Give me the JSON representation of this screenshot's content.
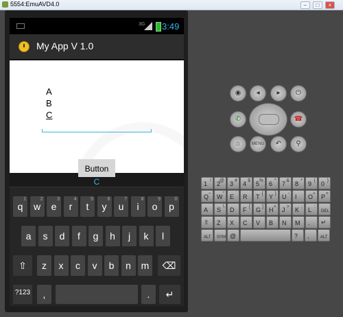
{
  "window": {
    "title": "5554:EmuAVD4.0"
  },
  "status_bar": {
    "network": "3G",
    "time": "3:49"
  },
  "app": {
    "title": "My App V 1.0",
    "list": [
      "A",
      "B",
      "C"
    ],
    "button_label": "Button"
  },
  "keyboard": {
    "suggestion": "C",
    "row1": [
      "q",
      "w",
      "e",
      "r",
      "t",
      "y",
      "u",
      "i",
      "o",
      "p"
    ],
    "row1_hints": [
      "1",
      "2",
      "3",
      "4",
      "5",
      "6",
      "7",
      "8",
      "9",
      "0"
    ],
    "row2": [
      "a",
      "s",
      "d",
      "f",
      "g",
      "h",
      "j",
      "k",
      "l"
    ],
    "row3": [
      "z",
      "x",
      "c",
      "v",
      "b",
      "n",
      "m"
    ],
    "shift_icon": "shift-icon",
    "delete_icon": "backspace-icon",
    "numbers_label": "?123",
    "comma_label": ",",
    "period_label": ".",
    "enter_icon": "enter-icon"
  },
  "emulator_controls": {
    "buttons": [
      "camera-icon",
      "volume-down-icon",
      "volume-up-icon",
      "power-icon",
      "call-icon",
      "end-call-icon",
      "home-icon",
      "MENU",
      "back-icon",
      "search-icon"
    ]
  },
  "hardware_keyboard": {
    "row1": [
      {
        "m": "1",
        "s": "!"
      },
      {
        "m": "2",
        "s": "@"
      },
      {
        "m": "3",
        "s": "#"
      },
      {
        "m": "4",
        "s": "$"
      },
      {
        "m": "5",
        "s": "%"
      },
      {
        "m": "6",
        "s": "^"
      },
      {
        "m": "7",
        "s": "&"
      },
      {
        "m": "8",
        "s": "*"
      },
      {
        "m": "9",
        "s": "("
      },
      {
        "m": "0",
        "s": ")"
      }
    ],
    "row2": [
      {
        "m": "Q",
        "s": "~"
      },
      {
        "m": "W",
        "s": "\""
      },
      {
        "m": "E",
        "s": "´"
      },
      {
        "m": "R",
        "s": ""
      },
      {
        "m": "T",
        "s": "{"
      },
      {
        "m": "Y",
        "s": "}"
      },
      {
        "m": "U",
        "s": "-"
      },
      {
        "m": "I",
        "s": ""
      },
      {
        "m": "O",
        "s": "+"
      },
      {
        "m": "P",
        "s": "="
      }
    ],
    "row3": [
      {
        "m": "A",
        "s": ""
      },
      {
        "m": "S",
        "s": "\\"
      },
      {
        "m": "D",
        "s": ""
      },
      {
        "m": "F",
        "s": "["
      },
      {
        "m": "G",
        "s": "]"
      },
      {
        "m": "H",
        "s": "<"
      },
      {
        "m": "J",
        "s": ">"
      },
      {
        "m": "K",
        "s": ";"
      },
      {
        "m": "L",
        "s": ":"
      },
      {
        "m": "DEL",
        "s": ""
      }
    ],
    "row4": [
      {
        "m": "⇧",
        "s": ""
      },
      {
        "m": "Z",
        "s": ""
      },
      {
        "m": "X",
        "s": ""
      },
      {
        "m": "C",
        "s": ""
      },
      {
        "m": "V",
        "s": ""
      },
      {
        "m": "B",
        "s": ""
      },
      {
        "m": "N",
        "s": ""
      },
      {
        "m": "M",
        "s": ""
      },
      {
        "m": ".",
        "s": ""
      },
      {
        "m": "↵",
        "s": ""
      }
    ],
    "row5": [
      {
        "m": "ALT",
        "s": ""
      },
      {
        "m": "SYM",
        "s": ""
      },
      {
        "m": "@",
        "s": ""
      },
      {
        "m": "",
        "s": ""
      },
      {
        "m": "?",
        "s": ""
      },
      {
        "m": ",",
        "s": ""
      },
      {
        "m": "ALT",
        "s": ""
      }
    ]
  }
}
